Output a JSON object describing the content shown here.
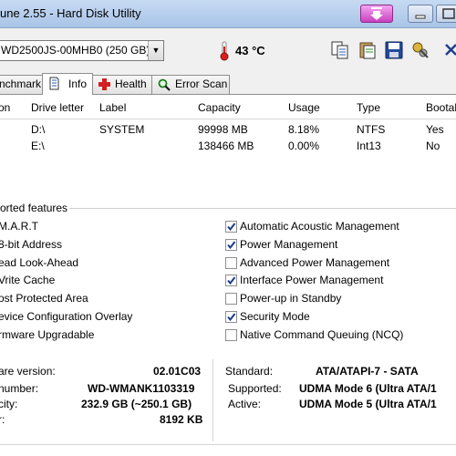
{
  "window": {
    "title": "une 2.55 - Hard Disk Utility"
  },
  "toolbar": {
    "disk": "WD2500JS-00MHB0 (250 GB)",
    "temperature": "43 °C"
  },
  "tabs": [
    {
      "label": "nchmark",
      "active": false
    },
    {
      "label": "Info",
      "active": true
    },
    {
      "label": "Health",
      "active": false
    },
    {
      "label": "Error Scan",
      "active": false
    }
  ],
  "partitions": {
    "headers": [
      "on",
      "Drive letter",
      "Label",
      "Capacity",
      "Usage",
      "Type",
      "Bootab"
    ],
    "rows": [
      {
        "drive": "D:\\",
        "label": "SYSTEM",
        "capacity": "99998 MB",
        "usage": "8.18%",
        "type": "NTFS",
        "bootable": "Yes"
      },
      {
        "drive": "E:\\",
        "label": "",
        "capacity": "138466 MB",
        "usage": "0.00%",
        "type": "Int13",
        "bootable": "No"
      }
    ]
  },
  "features": {
    "title": "orted features",
    "left": [
      {
        "label": "M.A.R.T"
      },
      {
        "label": "8-bit Address"
      },
      {
        "label": "ead Look-Ahead"
      },
      {
        "label": "Vrite Cache"
      },
      {
        "label": "ost Protected Area"
      },
      {
        "label": "evice Configuration Overlay"
      },
      {
        "label": "rmware Upgradable"
      }
    ],
    "right": [
      {
        "label": "Automatic Acoustic Management",
        "checked": true
      },
      {
        "label": "Power Management",
        "checked": true
      },
      {
        "label": "Advanced Power Management",
        "checked": false
      },
      {
        "label": "Interface Power Management",
        "checked": true
      },
      {
        "label": "Power-up in Standby",
        "checked": false
      },
      {
        "label": "Security Mode",
        "checked": true
      },
      {
        "label": "Native Command Queuing (NCQ)",
        "checked": false
      }
    ]
  },
  "details": {
    "firmware_label": "are version:",
    "firmware_value": "02.01C03",
    "serial_label": "number:",
    "serial_value": "WD-WMANK1103319",
    "capacity_label": "city:",
    "capacity_value": "232.9 GB (~250.1 GB)",
    "buffer_label": "r:",
    "buffer_value": "8192 KB",
    "standard_label": "Standard:",
    "standard_value": "ATA/ATAPI-7 - SATA",
    "supported_label": "Supported:",
    "supported_value": "UDMA Mode 6 (Ultra ATA/1",
    "active_label": "Active:",
    "active_value": "UDMA Mode 5 (Ultra ATA/1"
  },
  "colors": {
    "titlebar": "#b8d0ee",
    "check": "#1a3d8f",
    "temperature_icon": "#d42020"
  }
}
